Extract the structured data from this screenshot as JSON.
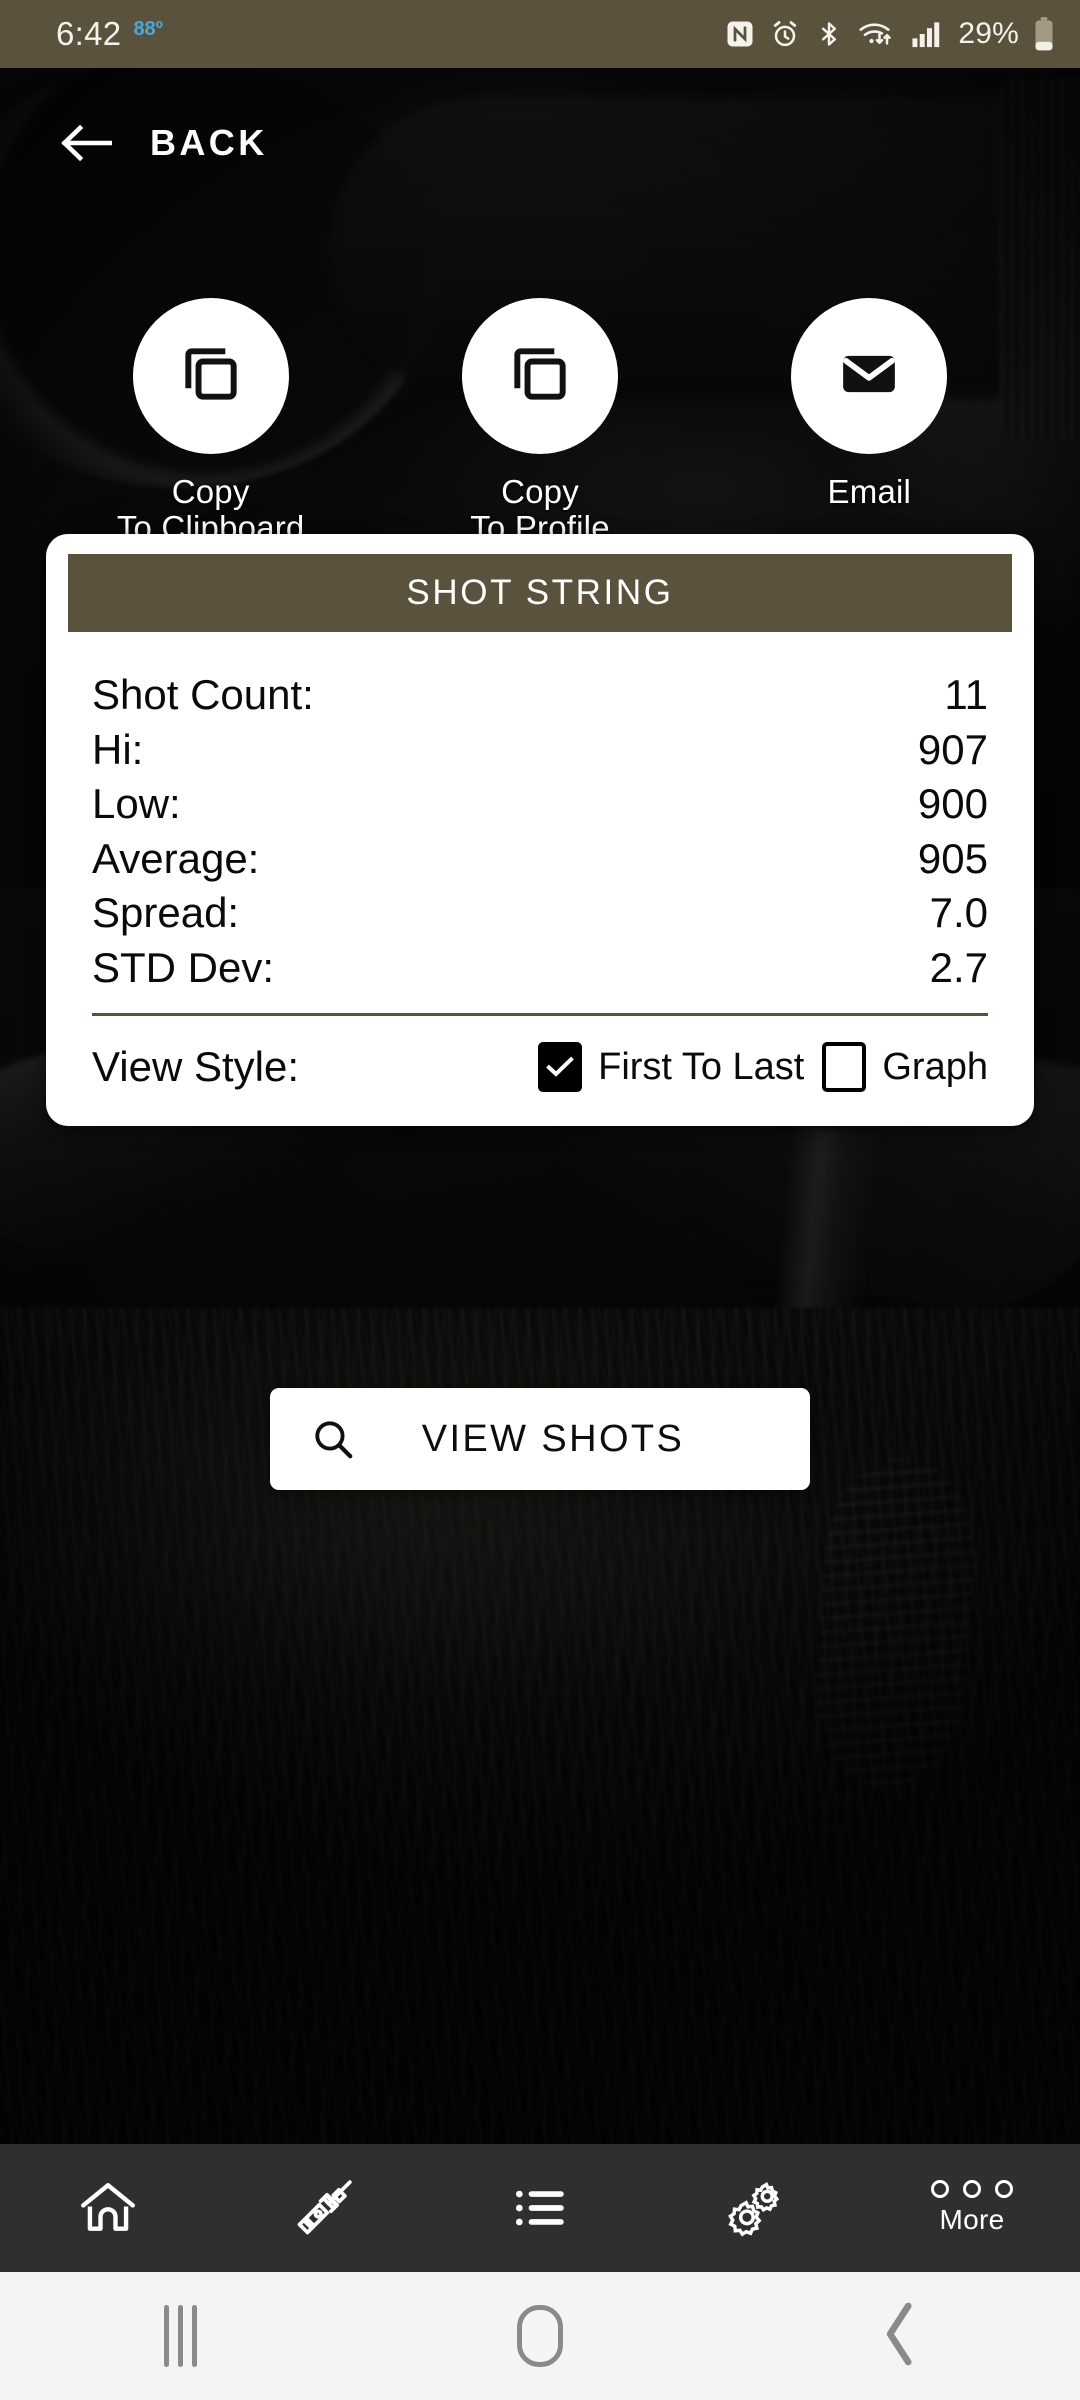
{
  "statusbar": {
    "time": "6:42",
    "temperature": "88º",
    "battery_percent": "29%",
    "icons": [
      "nfc-icon",
      "alarm-icon",
      "bluetooth-icon",
      "wifi-icon",
      "cellular-signal-icon",
      "battery-icon"
    ]
  },
  "header": {
    "back_label": "BACK",
    "back_icon": "arrow-left-icon"
  },
  "actions": [
    {
      "label_line1": "Copy",
      "label_line2": "To Clipboard",
      "icon": "copy-icon",
      "name": "copy-to-clipboard"
    },
    {
      "label_line1": "Copy",
      "label_line2": "To Profile",
      "icon": "copy-icon",
      "name": "copy-to-profile"
    },
    {
      "label_line1": "Email",
      "label_line2": "",
      "icon": "email-icon",
      "name": "email"
    }
  ],
  "card": {
    "title": "SHOT STRING",
    "header_color": "#5b523d",
    "stats": [
      {
        "label": "Shot Count:",
        "value": "11"
      },
      {
        "label": "Hi:",
        "value": "907"
      },
      {
        "label": "Low:",
        "value": "900"
      },
      {
        "label": "Average:",
        "value": "905"
      },
      {
        "label": "Spread:",
        "value": "7.0"
      },
      {
        "label": "STD Dev:",
        "value": "2.7"
      }
    ],
    "view_style": {
      "label": "View Style:",
      "options": [
        {
          "label": "First To Last",
          "checked": true
        },
        {
          "label": "Graph",
          "checked": false
        }
      ]
    }
  },
  "view_shots_button": {
    "label": "VIEW SHOTS",
    "icon": "search-icon"
  },
  "bottom_nav": [
    {
      "name": "home",
      "icon": "home-icon",
      "label": ""
    },
    {
      "name": "rifle",
      "icon": "rifle-scope-icon",
      "label": ""
    },
    {
      "name": "list",
      "icon": "list-icon",
      "label": ""
    },
    {
      "name": "settings",
      "icon": "gears-icon",
      "label": ""
    },
    {
      "name": "more",
      "icon": "three-dots-icon",
      "label": "More"
    }
  ],
  "system_nav": {
    "recents": "recents-icon",
    "home": "home-pill-icon",
    "back": "back-chevron-icon"
  }
}
